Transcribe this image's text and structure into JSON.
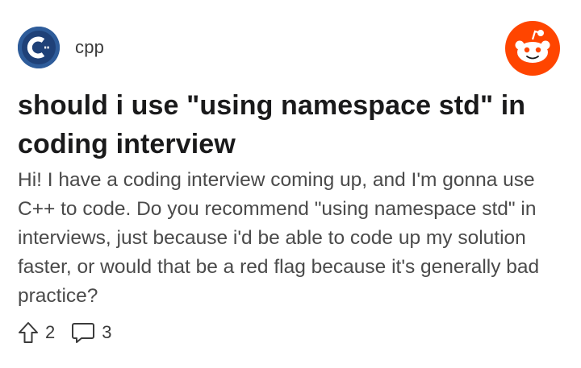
{
  "post": {
    "community": {
      "name": "cpp",
      "avatar_icon": "cpp-logo-icon",
      "avatar_color": "#2e5c9a"
    },
    "brand_icon": "reddit-logo-icon",
    "brand_color": "#ff4500",
    "title": "should i use \"using namespace std\" in coding interview",
    "body": "Hi! I have a coding interview coming up, and I'm gonna use C++ to code. Do you recommend \"using namespace std\" in interviews, just because i'd be able to code up my solution faster, or would that be a red flag because it's generally bad practice?",
    "upvotes": "2",
    "comments": "3",
    "upvote_icon": "upvote-arrow-icon",
    "comment_icon": "comment-bubble-icon"
  }
}
